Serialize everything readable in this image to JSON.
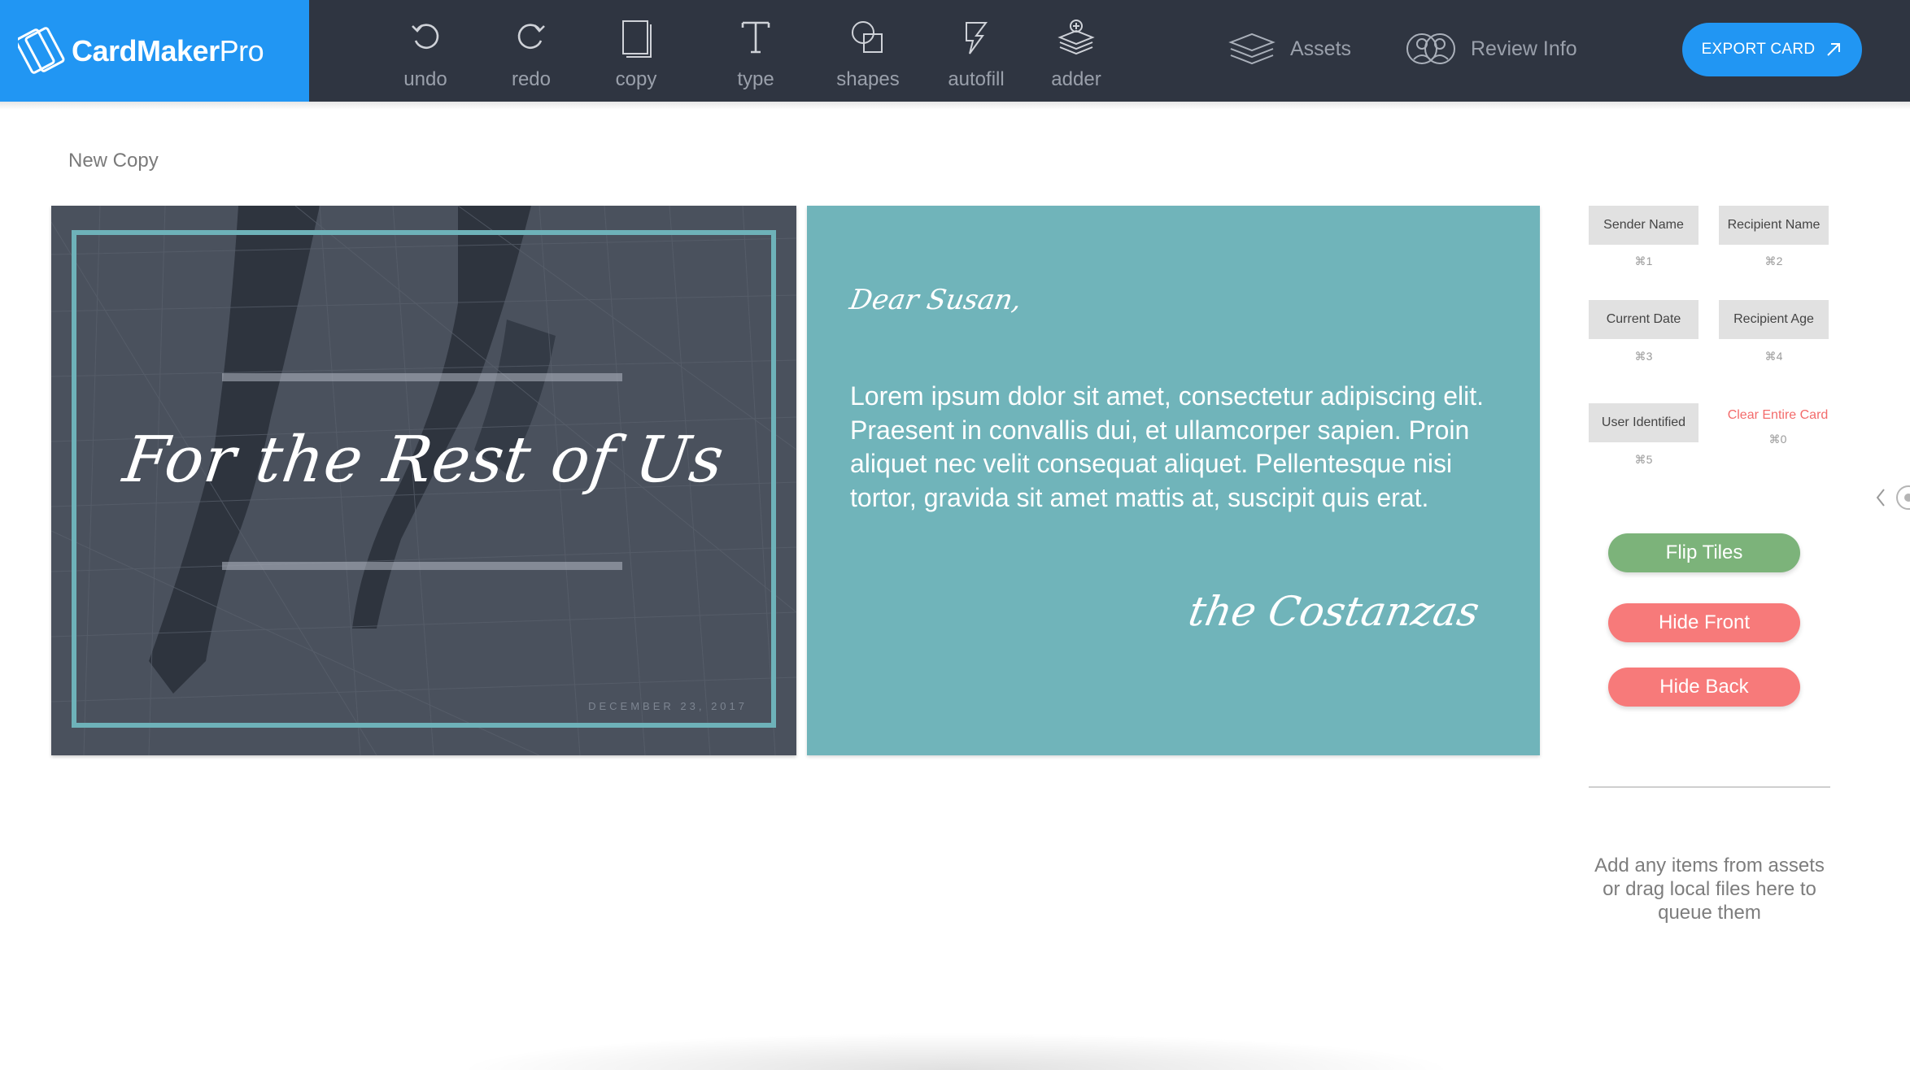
{
  "app": {
    "name_bold": "CardMaker",
    "name_light": "Pro"
  },
  "toolbar": {
    "tools": [
      {
        "label": "undo",
        "icon": "undo-icon"
      },
      {
        "label": "redo",
        "icon": "redo-icon"
      },
      {
        "label": "copy",
        "icon": "copy-icon"
      },
      {
        "label": "type",
        "icon": "type-icon"
      },
      {
        "label": "shapes",
        "icon": "shapes-icon"
      },
      {
        "label": "autofill",
        "icon": "autofill-icon"
      },
      {
        "label": "adder",
        "icon": "adder-icon"
      }
    ],
    "assets_label": "Assets",
    "review_label": "Review Info",
    "export_label": "EXPORT CARD"
  },
  "document": {
    "title": "New Copy"
  },
  "front": {
    "headline": "For the Rest of Us",
    "date": "DECEMBER 23, 2017"
  },
  "back": {
    "greeting": "Dear Susan,",
    "body": "Lorem ipsum dolor sit amet, consectetur adipiscing elit. Praesent in convallis dui, et ullamcorper sapien. Proin aliquet nec velit consequat aliquet. Pellentesque nisi tortor, gravida sit amet mattis at, suscipit quis erat.",
    "signature": "the Costanzas"
  },
  "fields": [
    {
      "label": "Sender Name",
      "shortcut": "⌘1"
    },
    {
      "label": "Recipient Name",
      "shortcut": "⌘2"
    },
    {
      "label": "Current Date",
      "shortcut": "⌘3"
    },
    {
      "label": "Recipient Age",
      "shortcut": "⌘4"
    },
    {
      "label": "User Identified",
      "shortcut": "⌘5"
    }
  ],
  "clear": {
    "label": "Clear Entire Card",
    "shortcut": "⌘0"
  },
  "actions": {
    "flip": "Flip Tiles",
    "hide_front": "Hide Front",
    "hide_back": "Hide Back"
  },
  "queue_hint": "Add any items from assets or drag local files here to queue them",
  "colors": {
    "brand": "#2196f3",
    "topbar": "#2f3541",
    "card_back": "#70b4ba",
    "frame": "#6eb2b9",
    "flip": "#7cb37a",
    "hide": "#f77a7a",
    "danger_text": "#f36b6b"
  }
}
